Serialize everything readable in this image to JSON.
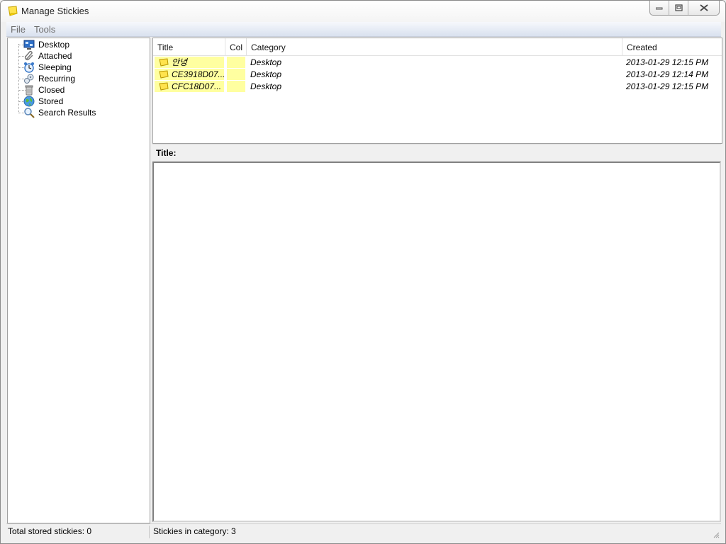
{
  "window": {
    "title": "Manage Stickies"
  },
  "menu": [
    {
      "label": "File"
    },
    {
      "label": "Tools"
    }
  ],
  "tree": {
    "items": [
      {
        "label": "Desktop",
        "icon": "desktop-icon"
      },
      {
        "label": "Attached",
        "icon": "paperclip-icon"
      },
      {
        "label": "Sleeping",
        "icon": "alarm-clock-icon"
      },
      {
        "label": "Recurring",
        "icon": "recurring-icon"
      },
      {
        "label": "Closed",
        "icon": "trash-can-icon"
      },
      {
        "label": "Stored",
        "icon": "globe-icon"
      },
      {
        "label": "Search Results",
        "icon": "magnifier-icon"
      }
    ]
  },
  "list": {
    "columns": [
      "Title",
      "Col",
      "Category",
      "Created"
    ],
    "rows": [
      {
        "title": "안녕",
        "category": "Desktop",
        "created": "2013-01-29 12:15 PM"
      },
      {
        "title": "CE3918D07...",
        "category": "Desktop",
        "created": "2013-01-29 12:14 PM"
      },
      {
        "title": "CFC18D07...",
        "category": "Desktop",
        "created": "2013-01-29 12:15 PM"
      }
    ],
    "note_color": "#ffffa0"
  },
  "detail": {
    "title_label": "Title:"
  },
  "status": {
    "total": "Total stored stickies: 0",
    "in_category": "Stickies in category: 3"
  }
}
